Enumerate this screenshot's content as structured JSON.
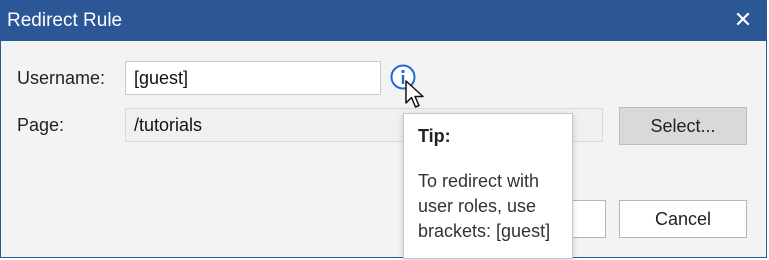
{
  "window": {
    "title": "Redirect Rule",
    "close_glyph": "✕"
  },
  "form": {
    "username_label": "Username:",
    "username_value": "[guest]",
    "page_label": "Page:",
    "page_value": "/tutorials"
  },
  "buttons": {
    "select_label": "Select...",
    "cancel_label": "Cancel"
  },
  "tooltip": {
    "title": "Tip:",
    "body": "To redirect with user roles, use brackets: [guest]"
  },
  "icons": {
    "info": "info-icon",
    "cursor": "cursor-icon",
    "close": "close-icon"
  },
  "colors": {
    "titlebar": "#2b5797",
    "accent_icon": "#1e6bd6"
  }
}
